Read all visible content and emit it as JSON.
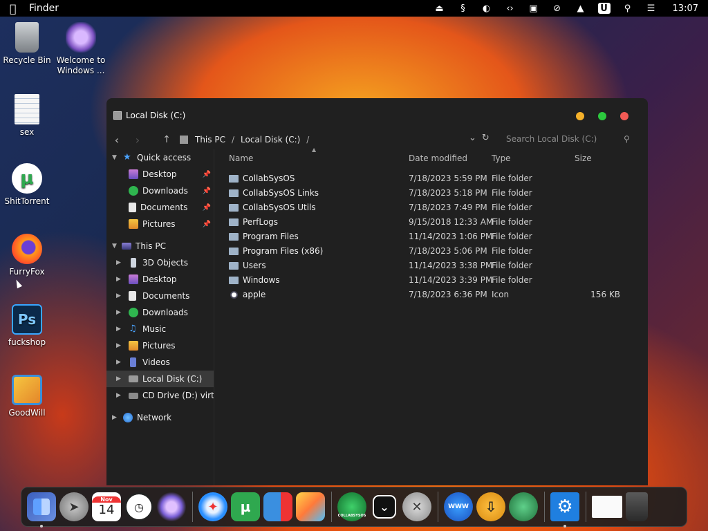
{
  "menubar": {
    "app_name": "Finder",
    "clock": "13:07",
    "icons": [
      "eject-icon",
      "sound-icon",
      "contrast-icon",
      "code-icon",
      "display-icon",
      "no-wifi-icon",
      "eject-up-icon",
      "u-badge-icon",
      "search-icon",
      "control-center-icon"
    ]
  },
  "desktop": {
    "icons": [
      {
        "label": "Recycle Bin",
        "icon": "recycle-bin-icon",
        "color": "#9aa0a6"
      },
      {
        "label": "Welcome to Windows ...",
        "icon": "welcome-app-icon",
        "color": "#b58ce0"
      },
      {
        "label": "sex",
        "icon": "notepad-icon",
        "color": "#f2f2f2"
      },
      {
        "label": "ShitTorrent",
        "icon": "utorrent-icon",
        "color": "#2fa84f"
      },
      {
        "label": "FurryFox",
        "icon": "firefox-icon",
        "color": "#ff7a1a"
      },
      {
        "label": "fuckshop",
        "icon": "photoshop-icon",
        "color": "#2a5fa8"
      },
      {
        "label": "GoodWill",
        "icon": "goodwill-icon",
        "color": "#f0a530"
      }
    ]
  },
  "window": {
    "title": "Local Disk (C:)",
    "breadcrumb": [
      "This PC",
      "Local Disk (C:)"
    ],
    "search_placeholder": "Search Local Disk (C:)",
    "sidebar": {
      "quick_access": {
        "label": "Quick access",
        "items": [
          {
            "label": "Desktop",
            "icon": "desktop-icon",
            "pinned": true
          },
          {
            "label": "Downloads",
            "icon": "downloads-icon",
            "pinned": true
          },
          {
            "label": "Documents",
            "icon": "documents-icon",
            "pinned": true
          },
          {
            "label": "Pictures",
            "icon": "pictures-icon",
            "pinned": true
          }
        ]
      },
      "this_pc": {
        "label": "This PC",
        "items": [
          {
            "label": "3D Objects",
            "icon": "3d-objects-icon"
          },
          {
            "label": "Desktop",
            "icon": "desktop-icon"
          },
          {
            "label": "Documents",
            "icon": "documents-icon"
          },
          {
            "label": "Downloads",
            "icon": "downloads-icon"
          },
          {
            "label": "Music",
            "icon": "music-icon"
          },
          {
            "label": "Pictures",
            "icon": "pictures-icon"
          },
          {
            "label": "Videos",
            "icon": "videos-icon"
          },
          {
            "label": "Local Disk (C:)",
            "icon": "drive-icon",
            "selected": true
          },
          {
            "label": "CD Drive (D:) virtio-",
            "icon": "cd-drive-icon"
          }
        ]
      },
      "network": {
        "label": "Network"
      }
    },
    "columns": {
      "name": "Name",
      "date": "Date modified",
      "type": "Type",
      "size": "Size"
    },
    "files": [
      {
        "name": "CollabSysOS",
        "date": "7/18/2023 5:59 PM",
        "type": "File folder",
        "size": ""
      },
      {
        "name": "CollabSysOS Links",
        "date": "7/18/2023 5:18 PM",
        "type": "File folder",
        "size": ""
      },
      {
        "name": "CollabSysOS Utils",
        "date": "7/18/2023 7:49 PM",
        "type": "File folder",
        "size": ""
      },
      {
        "name": "PerfLogs",
        "date": "9/15/2018 12:33 AM",
        "type": "File folder",
        "size": ""
      },
      {
        "name": "Program Files",
        "date": "11/14/2023 1:06 PM",
        "type": "File folder",
        "size": ""
      },
      {
        "name": "Program Files (x86)",
        "date": "7/18/2023 5:06 PM",
        "type": "File folder",
        "size": ""
      },
      {
        "name": "Users",
        "date": "11/14/2023 3:38 PM",
        "type": "File folder",
        "size": ""
      },
      {
        "name": "Windows",
        "date": "11/14/2023 3:39 PM",
        "type": "File folder",
        "size": ""
      },
      {
        "name": "apple",
        "date": "7/18/2023 6:36 PM",
        "type": "Icon",
        "size": "156 KB"
      }
    ]
  },
  "dock": {
    "calendar_month": "Nov",
    "calendar_day": "14",
    "collab_label": "COLLABSYSOS",
    "www_label": "WWW"
  }
}
